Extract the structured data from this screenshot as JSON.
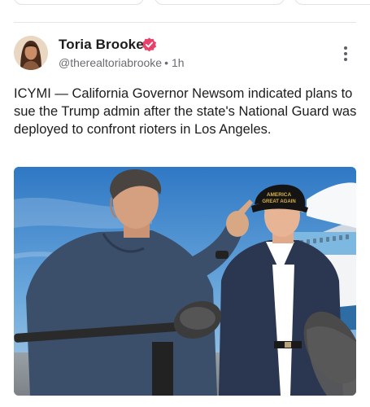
{
  "post": {
    "author_name": "Toria Brooke",
    "handle": "@therealtoriabrooke",
    "separator": "•",
    "time": "1h",
    "text": "ICYMI — California Governor Newsom indicated plans to sue the Trump admin after the state's National Guard was deployed to confront rioters in Los Angeles.",
    "media": {
      "hat_text_line1": "AMERICA",
      "hat_text_line2": "GREAT AGAIN"
    }
  },
  "icons": {
    "verified": "verified-badge-icon",
    "more": "more-vertical-icon"
  },
  "colors": {
    "verified_badge": "#e8426b",
    "secondary_text": "#6b6b73",
    "divider": "#e6e6ea"
  }
}
